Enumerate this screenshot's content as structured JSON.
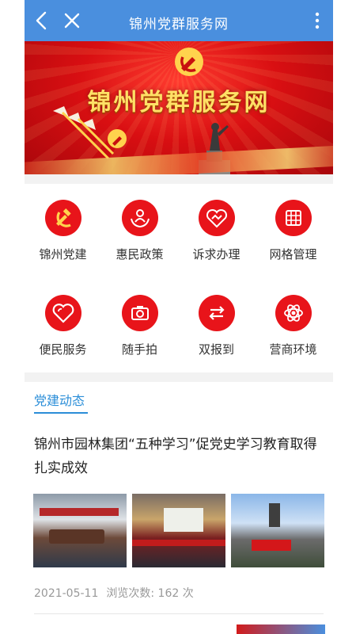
{
  "header": {
    "title": "锦州党群服务网",
    "back_icon": "back-arrow-icon",
    "close_icon": "close-icon",
    "more_icon": "more-vertical-icon"
  },
  "banner": {
    "heading": "锦州党群服务网",
    "slides": 2,
    "active_slide": 1
  },
  "services": [
    {
      "label": "锦州党建",
      "icon": "party-emblem-icon"
    },
    {
      "label": "惠民政策",
      "icon": "people-hands-icon"
    },
    {
      "label": "诉求办理",
      "icon": "handshake-heart-icon"
    },
    {
      "label": "网格管理",
      "icon": "grid-icon"
    },
    {
      "label": "便民服务",
      "icon": "heart-icon"
    },
    {
      "label": "随手拍",
      "icon": "camera-icon"
    },
    {
      "label": "双报到",
      "icon": "swap-arrows-icon"
    },
    {
      "label": "营商环境",
      "icon": "atom-icon"
    }
  ],
  "news": {
    "section_title": "党建动态",
    "article": {
      "title": "锦州市园林集团“五种学习”促党史学习教育取得扎实成效",
      "date": "2021-05-11",
      "views": "浏览次数: 162 次"
    }
  },
  "colors": {
    "header_blue": "#4a8fde",
    "icon_red": "#e8141a",
    "tab_blue": "#2b8ed8"
  }
}
